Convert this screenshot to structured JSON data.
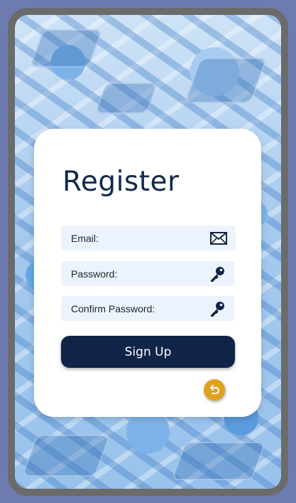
{
  "form": {
    "title": "Register",
    "fields": [
      {
        "label": "Email:",
        "icon": "envelope-icon"
      },
      {
        "label": "Password:",
        "icon": "key-icon"
      },
      {
        "label": "Confirm Password:",
        "icon": "key-icon"
      }
    ],
    "signup_label": "Sign Up",
    "back_icon": "undo-icon"
  },
  "colors": {
    "frame": "#6b6b6b",
    "page_bg": "#6e7bb0",
    "title": "#0f2a4d",
    "field_bg": "#edf3fc",
    "button": "#0f2448",
    "back_button": "#e0a21d"
  }
}
